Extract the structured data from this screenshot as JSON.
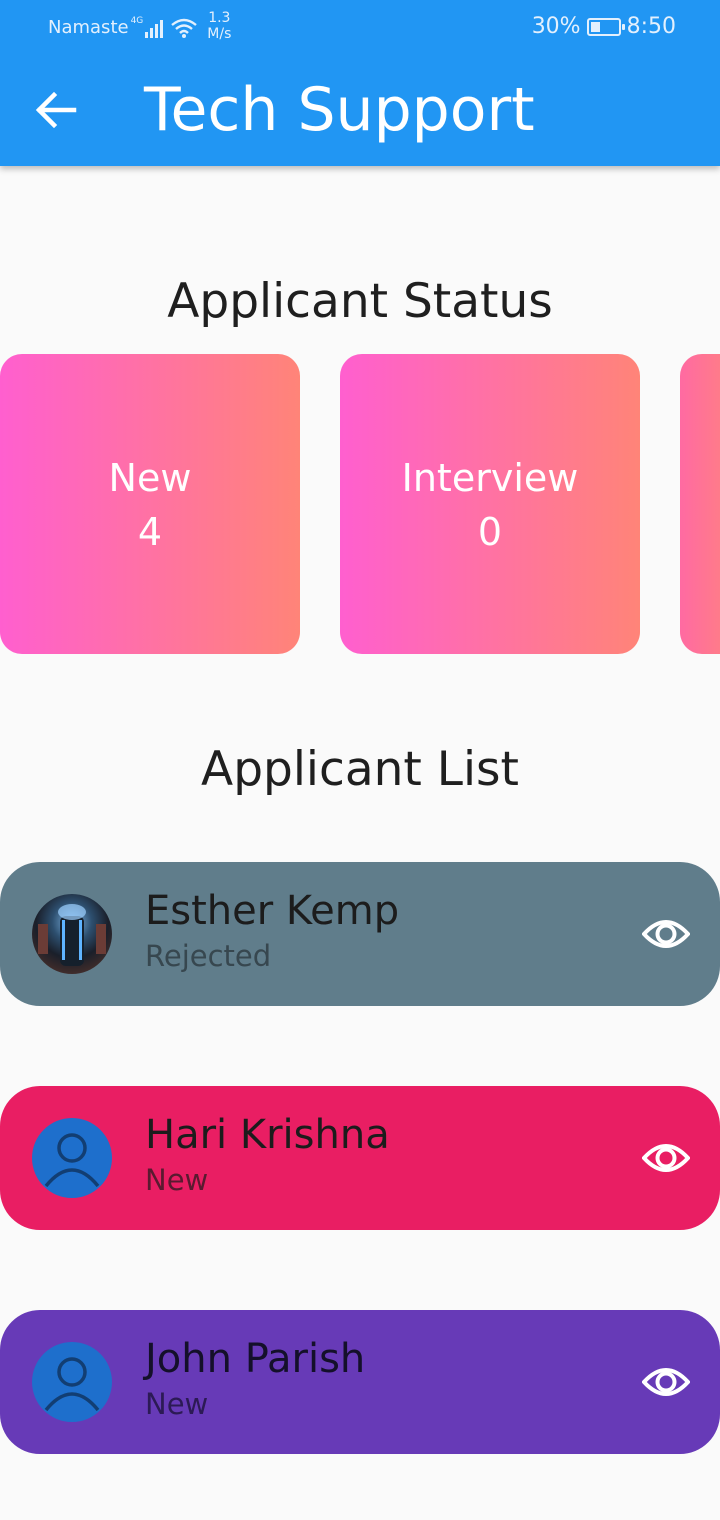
{
  "status_bar": {
    "carrier": "Namaste",
    "network": "4G",
    "speed_value": "1.3",
    "speed_unit": "M/s",
    "battery": "30%",
    "time": "8:50"
  },
  "app_bar": {
    "title": "Tech Support",
    "back_icon": "arrow-back-icon"
  },
  "status_section": {
    "title": "Applicant Status",
    "cards": [
      {
        "label": "New",
        "count": "4"
      },
      {
        "label": "Interview",
        "count": "0"
      }
    ]
  },
  "list_section": {
    "title": "Applicant List",
    "applicants": [
      {
        "name": "Esther Kemp",
        "status": "Rejected",
        "color": "#607d8b",
        "avatar": "photo"
      },
      {
        "name": "Hari Krishna",
        "status": "New",
        "color": "#e91e63",
        "avatar": "person-icon"
      },
      {
        "name": "John Parish",
        "status": "New",
        "color": "#673ab7",
        "avatar": "person-icon"
      }
    ]
  },
  "colors": {
    "app_bar": "#2196f3",
    "card_gradient_start": "#ff5fcf",
    "card_gradient_end": "#ff8478"
  }
}
